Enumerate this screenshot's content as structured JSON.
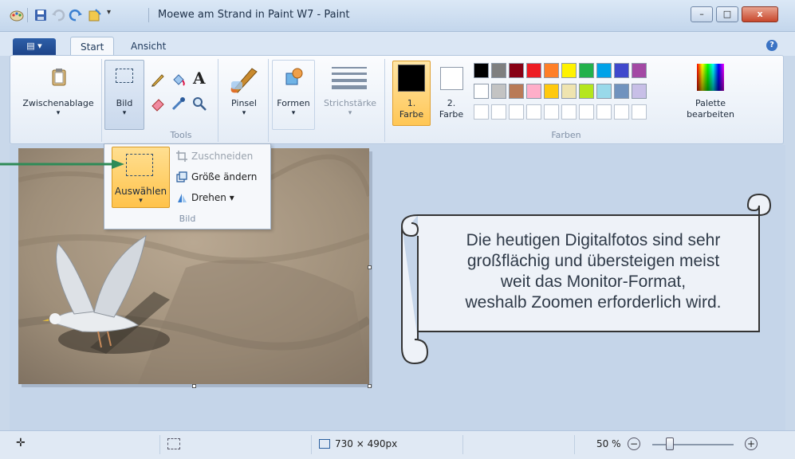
{
  "window": {
    "title": "Moewe am Strand in Paint W7 - Paint",
    "min_label": "–",
    "max_label": "□",
    "close_label": "x"
  },
  "tabs": {
    "file_label": "▤ ▾",
    "start": "Start",
    "ansicht": "Ansicht",
    "help": "?"
  },
  "ribbon": {
    "clipboard": "Zwischenablage",
    "image": "Bild",
    "tools_caption": "Tools",
    "brush": "Pinsel",
    "shapes": "Formen",
    "stroke": "Strichstärke",
    "color1_line1": "1.",
    "color1_line2": "Farbe",
    "color2_line1": "2.",
    "color2_line2": "Farbe",
    "colors_caption": "Farben",
    "edit_palette_line1": "Palette",
    "edit_palette_line2": "bearbeiten",
    "text_tool": "A",
    "dropdown_arrow": "▾"
  },
  "palette_row1": [
    "#000000",
    "#7f7f7f",
    "#880015",
    "#ed1c24",
    "#ff7f27",
    "#fff200",
    "#22b14c",
    "#00a2e8",
    "#3f48cc",
    "#a349a4"
  ],
  "palette_row2": [
    "#ffffff",
    "#c3c3c3",
    "#b97a57",
    "#ffaec9",
    "#ffc90e",
    "#efe4b0",
    "#b5e61d",
    "#99d9ea",
    "#7092be",
    "#c8bfe7"
  ],
  "colors": {
    "accent": "#ffc34b",
    "arrow": "#2e8b57"
  },
  "image_menu": {
    "select": "Auswählen",
    "crop": "Zuschneiden",
    "resize": "Größe ändern",
    "rotate": "Drehen ▾",
    "caption": "Bild"
  },
  "callout": {
    "line1": "Die heutigen Digitalfotos sind sehr",
    "line2": "großflächig und übersteigen meist",
    "line3": "weit das Monitor-Format,",
    "line4": "weshalb Zoomen erforderlich wird."
  },
  "status": {
    "image_size": "730 × 490px",
    "zoom": "50 %",
    "zoom_minus": "−",
    "zoom_plus": "+",
    "zoom_level": 0.5
  }
}
